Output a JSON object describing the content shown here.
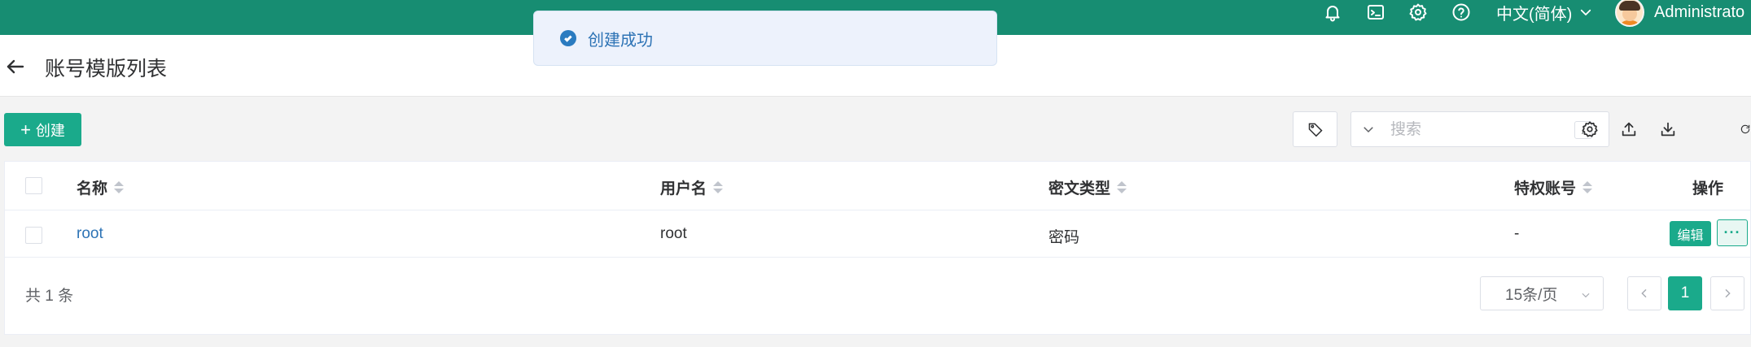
{
  "topbar": {
    "icons": [
      "bell-icon",
      "terminal-icon",
      "gear-icon",
      "help-icon"
    ],
    "language": "中文(简体)",
    "username": "Administrato"
  },
  "page": {
    "title": "账号模版列表"
  },
  "toast": {
    "message": "创建成功"
  },
  "toolbar": {
    "create_label": "创建",
    "search_placeholder": "搜索",
    "search_shortcut": "/",
    "tools": [
      "settings-icon",
      "export-icon",
      "import-icon",
      "refresh-icon"
    ]
  },
  "table": {
    "columns": {
      "name": "名称",
      "username": "用户名",
      "secret_type": "密文类型",
      "privileged": "特权账号",
      "actions": "操作"
    },
    "rows": [
      {
        "name": "root",
        "username": "root",
        "secret_type": "密码",
        "privileged": "-",
        "edit_label": "编辑",
        "more_label": "···"
      }
    ]
  },
  "pagination": {
    "total": "共 1 条",
    "page_size": "15条/页",
    "current_page": "1"
  },
  "colors": {
    "header_bg": "#178d72",
    "primary": "#1aaa8b",
    "link": "#2d73b5"
  }
}
